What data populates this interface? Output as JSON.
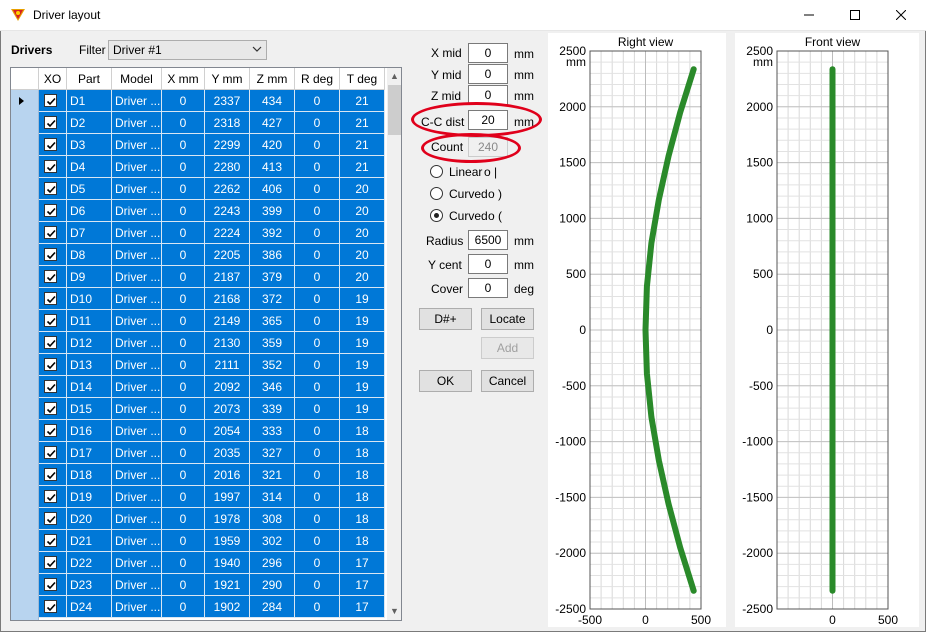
{
  "window": {
    "title": "Driver layout",
    "minimize": "—",
    "maximize": "☐",
    "close": "✕"
  },
  "drivers_panel": {
    "heading": "Drivers",
    "filter_label": "Filter",
    "filter_value": "Driver #1",
    "columns": [
      "XO",
      "Part",
      "Model",
      "X mm",
      "Y mm",
      "Z mm",
      "R deg",
      "T deg"
    ],
    "rows": [
      {
        "xo": true,
        "part": "D1",
        "model": "Driver ...",
        "x": "0",
        "y": "2337",
        "z": "434",
        "r": "0",
        "t": "21"
      },
      {
        "xo": true,
        "part": "D2",
        "model": "Driver ...",
        "x": "0",
        "y": "2318",
        "z": "427",
        "r": "0",
        "t": "21"
      },
      {
        "xo": true,
        "part": "D3",
        "model": "Driver ...",
        "x": "0",
        "y": "2299",
        "z": "420",
        "r": "0",
        "t": "21"
      },
      {
        "xo": true,
        "part": "D4",
        "model": "Driver ...",
        "x": "0",
        "y": "2280",
        "z": "413",
        "r": "0",
        "t": "21"
      },
      {
        "xo": true,
        "part": "D5",
        "model": "Driver ...",
        "x": "0",
        "y": "2262",
        "z": "406",
        "r": "0",
        "t": "20"
      },
      {
        "xo": true,
        "part": "D6",
        "model": "Driver ...",
        "x": "0",
        "y": "2243",
        "z": "399",
        "r": "0",
        "t": "20"
      },
      {
        "xo": true,
        "part": "D7",
        "model": "Driver ...",
        "x": "0",
        "y": "2224",
        "z": "392",
        "r": "0",
        "t": "20"
      },
      {
        "xo": true,
        "part": "D8",
        "model": "Driver ...",
        "x": "0",
        "y": "2205",
        "z": "386",
        "r": "0",
        "t": "20"
      },
      {
        "xo": true,
        "part": "D9",
        "model": "Driver ...",
        "x": "0",
        "y": "2187",
        "z": "379",
        "r": "0",
        "t": "20"
      },
      {
        "xo": true,
        "part": "D10",
        "model": "Driver ...",
        "x": "0",
        "y": "2168",
        "z": "372",
        "r": "0",
        "t": "19"
      },
      {
        "xo": true,
        "part": "D11",
        "model": "Driver ...",
        "x": "0",
        "y": "2149",
        "z": "365",
        "r": "0",
        "t": "19"
      },
      {
        "xo": true,
        "part": "D12",
        "model": "Driver ...",
        "x": "0",
        "y": "2130",
        "z": "359",
        "r": "0",
        "t": "19"
      },
      {
        "xo": true,
        "part": "D13",
        "model": "Driver ...",
        "x": "0",
        "y": "2111",
        "z": "352",
        "r": "0",
        "t": "19"
      },
      {
        "xo": true,
        "part": "D14",
        "model": "Driver ...",
        "x": "0",
        "y": "2092",
        "z": "346",
        "r": "0",
        "t": "19"
      },
      {
        "xo": true,
        "part": "D15",
        "model": "Driver ...",
        "x": "0",
        "y": "2073",
        "z": "339",
        "r": "0",
        "t": "19"
      },
      {
        "xo": true,
        "part": "D16",
        "model": "Driver ...",
        "x": "0",
        "y": "2054",
        "z": "333",
        "r": "0",
        "t": "18"
      },
      {
        "xo": true,
        "part": "D17",
        "model": "Driver ...",
        "x": "0",
        "y": "2035",
        "z": "327",
        "r": "0",
        "t": "18"
      },
      {
        "xo": true,
        "part": "D18",
        "model": "Driver ...",
        "x": "0",
        "y": "2016",
        "z": "321",
        "r": "0",
        "t": "18"
      },
      {
        "xo": true,
        "part": "D19",
        "model": "Driver ...",
        "x": "0",
        "y": "1997",
        "z": "314",
        "r": "0",
        "t": "18"
      },
      {
        "xo": true,
        "part": "D20",
        "model": "Driver ...",
        "x": "0",
        "y": "1978",
        "z": "308",
        "r": "0",
        "t": "18"
      },
      {
        "xo": true,
        "part": "D21",
        "model": "Driver ...",
        "x": "0",
        "y": "1959",
        "z": "302",
        "r": "0",
        "t": "18"
      },
      {
        "xo": true,
        "part": "D22",
        "model": "Driver ...",
        "x": "0",
        "y": "1940",
        "z": "296",
        "r": "0",
        "t": "17"
      },
      {
        "xo": true,
        "part": "D23",
        "model": "Driver ...",
        "x": "0",
        "y": "1921",
        "z": "290",
        "r": "0",
        "t": "17"
      },
      {
        "xo": true,
        "part": "D24",
        "model": "Driver ...",
        "x": "0",
        "y": "1902",
        "z": "284",
        "r": "0",
        "t": "17"
      }
    ]
  },
  "params": {
    "x_mid_label": "X mid",
    "x_mid_value": "0",
    "x_mid_unit": "mm",
    "y_mid_label": "Y mid",
    "y_mid_value": "0",
    "y_mid_unit": "mm",
    "z_mid_label": "Z mid",
    "z_mid_value": "0",
    "z_mid_unit": "mm",
    "cc_dist_label": "C-C dist",
    "cc_dist_value": "20",
    "cc_dist_unit": "mm",
    "count_label": "Count",
    "count_value": "240",
    "radio_linear": "Linear",
    "radio_linear_glyph": "o  |",
    "radio_curved1": "Curved",
    "radio_curved1_glyph": "o  )",
    "radio_curved2": "Curved",
    "radio_curved2_glyph": "o  (",
    "selected_radio": "curved2",
    "radius_label": "Radius",
    "radius_value": "6500",
    "radius_unit": "mm",
    "ycent_label": "Y cent",
    "ycent_value": "0",
    "ycent_unit": "mm",
    "cover_label": "Cover",
    "cover_value": "0",
    "cover_unit": "deg",
    "btn_dsharp": "D#+",
    "btn_locate": "Locate",
    "btn_add": "Add",
    "btn_ok": "OK",
    "btn_cancel": "Cancel"
  },
  "colors": {
    "selection": "#0078d7",
    "line": "#2a8a2a",
    "highlight": "#e0001b"
  },
  "chart_data": [
    {
      "type": "line",
      "title": "Right view",
      "ylabel": "mm",
      "xlim": [
        -500,
        500
      ],
      "ylim": [
        -2500,
        2500
      ],
      "xticks": [
        -500,
        0,
        500
      ],
      "yticks": [
        2500,
        2000,
        1500,
        1000,
        500,
        0,
        -500,
        -1000,
        -1500,
        -2000,
        -2500
      ],
      "grid": true,
      "series": [
        {
          "x": [
            434,
            313,
            208,
            121,
            53,
            13,
            0,
            13,
            53,
            121,
            208,
            313,
            434
          ],
          "y": [
            2337,
            1950,
            1560,
            1170,
            780,
            390,
            0,
            -390,
            -780,
            -1170,
            -1560,
            -1950,
            -2337
          ]
        }
      ]
    },
    {
      "type": "line",
      "title": "Front view",
      "ylabel": "mm",
      "xlim": [
        -500,
        500
      ],
      "ylim": [
        -2500,
        2500
      ],
      "xticks": [
        0,
        500
      ],
      "yticks": [
        2500,
        2000,
        1500,
        1000,
        500,
        0,
        -500,
        -1000,
        -1500,
        -2000,
        -2500
      ],
      "grid": true,
      "series": [
        {
          "x": [
            0,
            0
          ],
          "y": [
            2337,
            -2337
          ]
        }
      ]
    }
  ]
}
